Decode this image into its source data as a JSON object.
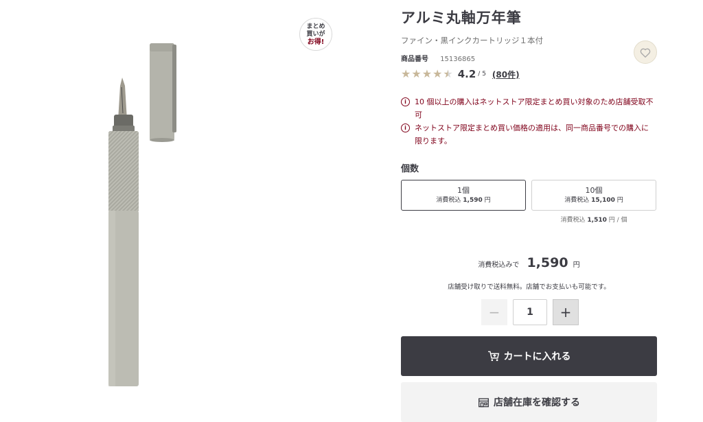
{
  "product": {
    "title": "アルミ丸軸万年筆",
    "subtitle": "ファイン・黒インクカートリッジ１本付",
    "code_label": "商品番号",
    "code_value": "15136865",
    "badge": {
      "line1": "まとめ",
      "line2": "買いが",
      "line3": "お得!"
    },
    "image_icon": "fountain-pen-image"
  },
  "rating": {
    "score": "4.2",
    "max": "/ 5",
    "reviews_link": "(80件)",
    "stars_value": 4.2,
    "star_color": "#c8b89a"
  },
  "favorite": {
    "icon": "heart-icon"
  },
  "notices": [
    {
      "icon": "info-icon",
      "text": "10 個以上の購入はネットストア限定まとめ買い対象のため店舗受取不可"
    },
    {
      "icon": "info-icon",
      "text": "ネットストア限定まとめ買い価格の適用は、同一商品番号での購入に限ります。"
    }
  ],
  "quantity_section": {
    "label": "個数",
    "options": [
      {
        "count": "1個",
        "price_label": "消費税込",
        "price": "1,590",
        "unit": "円",
        "selected": true
      },
      {
        "count": "10個",
        "price_label": "消費税込",
        "price": "15,100",
        "unit": "円",
        "selected": false
      }
    ],
    "per_unit": {
      "label": "消費税込",
      "price": "1,510",
      "unit": "円 / 個"
    }
  },
  "total": {
    "label": "消費税込みで",
    "value": "1,590",
    "unit": "円",
    "shipping_note": "店舗受け取りで送料無料。店舗でお支払いも可能です。"
  },
  "stepper": {
    "minus": "−",
    "plus": "+",
    "value": "1"
  },
  "buttons": {
    "cart": "カートに入れる",
    "store_stock": "店舗在庫を確認する"
  },
  "colors": {
    "accent_dark": "#3c3c43",
    "notice_red": "#7f0019",
    "fav_bg": "#f4efe3"
  }
}
